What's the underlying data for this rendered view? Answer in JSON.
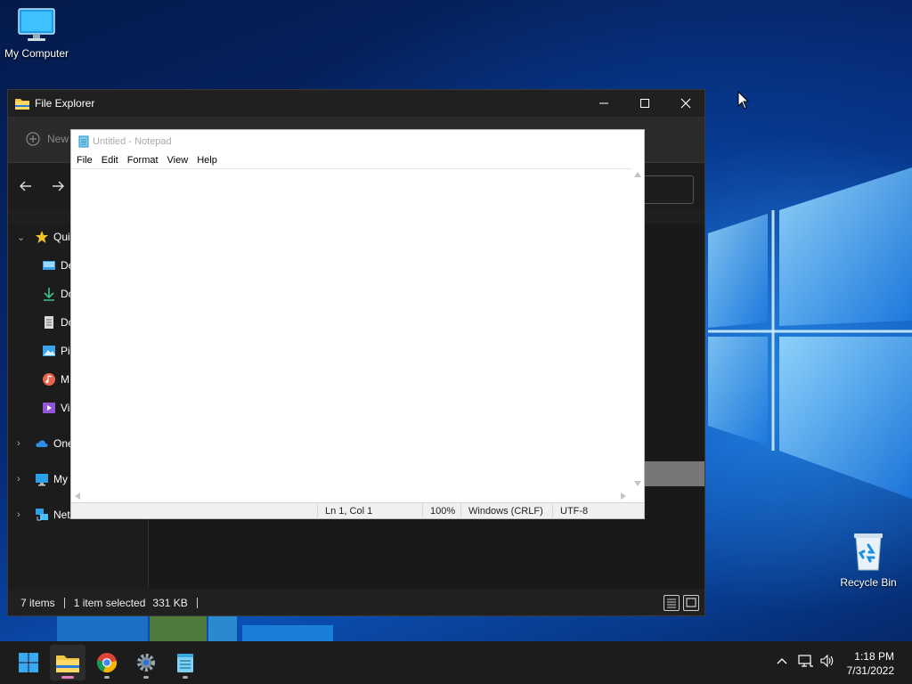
{
  "desktop": {
    "icons": [
      {
        "label": "My Computer",
        "icon": "monitor-icon"
      },
      {
        "label": "Recycle Bin",
        "icon": "recycle-bin-icon"
      }
    ]
  },
  "explorer": {
    "title": "File Explorer",
    "new_label": "New",
    "nav": [
      {
        "label": "Quick access",
        "visible": "Qui",
        "icon": "star-icon"
      },
      {
        "label": "Desktop",
        "visible": "De",
        "icon": "desktop-folder-icon"
      },
      {
        "label": "Downloads",
        "visible": "Do",
        "icon": "download-icon"
      },
      {
        "label": "Documents",
        "visible": "Do",
        "icon": "document-icon"
      },
      {
        "label": "Pictures",
        "visible": "Pi",
        "icon": "pictures-icon"
      },
      {
        "label": "Music",
        "visible": "M",
        "icon": "music-icon"
      },
      {
        "label": "Videos",
        "visible": "Vi",
        "icon": "video-icon"
      },
      {
        "label": "OneDrive",
        "visible": "One",
        "icon": "cloud-icon"
      },
      {
        "label": "My Computer",
        "visible": "My",
        "icon": "computer-icon"
      },
      {
        "label": "Network",
        "visible": "Net",
        "icon": "network-icon"
      }
    ],
    "status": {
      "items": "7 items",
      "selected": "1 item selected",
      "size": "331 KB"
    }
  },
  "notepad": {
    "title": "Untitled - Notepad",
    "menu": [
      "File",
      "Edit",
      "Format",
      "View",
      "Help"
    ],
    "text": "",
    "status": {
      "position": "Ln 1, Col 1",
      "zoom": "100%",
      "line_endings": "Windows (CRLF)",
      "encoding": "UTF-8"
    }
  },
  "taskbar": {
    "apps": [
      {
        "name": "start",
        "icon": "windows-start-icon"
      },
      {
        "name": "file-explorer",
        "icon": "folder-icon"
      },
      {
        "name": "chrome",
        "icon": "chrome-icon"
      },
      {
        "name": "settings",
        "icon": "gear-icon"
      },
      {
        "name": "notepad",
        "icon": "notepad-icon"
      }
    ],
    "clock": {
      "time": "1:18 PM",
      "date": "7/31/2022"
    }
  },
  "colors": {
    "accent": "#0078d4",
    "explorer_bg": "#1f1f1f",
    "taskbar_bg": "#1c1c1c"
  }
}
